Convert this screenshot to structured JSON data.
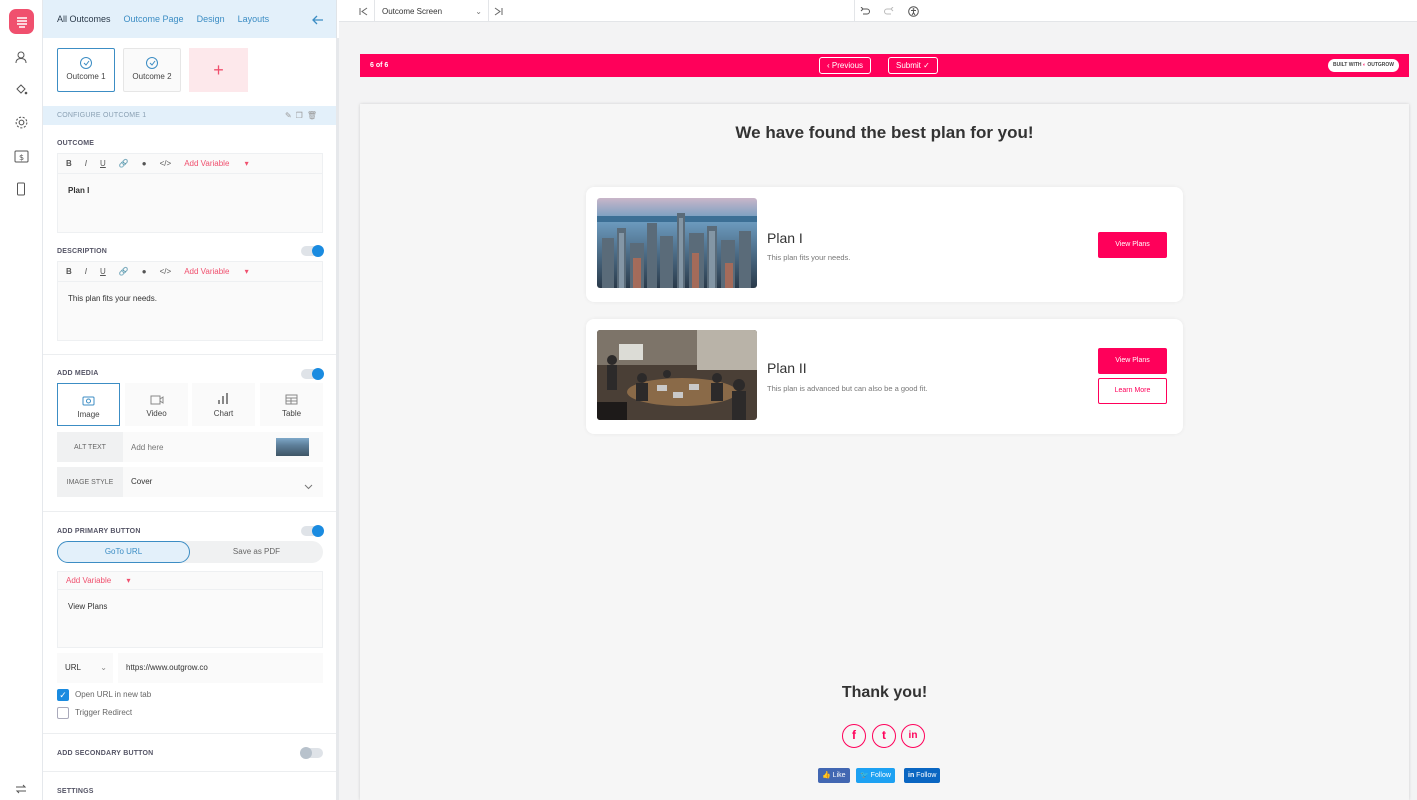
{
  "sidebar": {
    "tabs": [
      "All Outcomes",
      "Outcome Page",
      "Design",
      "Layouts"
    ],
    "outcomes": [
      "Outcome 1",
      "Outcome 2"
    ],
    "add_symbol": "+",
    "configure_label": "CONFIGURE OUTCOME 1",
    "outcome_section": "OUTCOME",
    "toolbar": {
      "bold": "B",
      "italic": "I",
      "underline": "U",
      "add_variable": "Add Variable"
    },
    "outcome_text": "Plan I",
    "description_section": "DESCRIPTION",
    "description_text": "This plan fits your needs.",
    "media_section": "ADD MEDIA",
    "media_options": [
      "Image",
      "Video",
      "Chart",
      "Table"
    ],
    "alt_text_label": "ALT TEXT",
    "alt_text_placeholder": "Add here",
    "image_style_label": "IMAGE STYLE",
    "image_style_value": "Cover",
    "primary_button_section": "ADD PRIMARY BUTTON",
    "primary_tabs": [
      "GoTo URL",
      "Save as PDF"
    ],
    "button_text": "View Plans",
    "url_type": "URL",
    "url_value": "https://www.outgrow.co",
    "open_new_tab": "Open URL in new tab",
    "trigger_redirect": "Trigger Redirect",
    "secondary_button_section": "ADD SECONDARY BUTTON",
    "settings_section": "SETTINGS",
    "toggles": {
      "description": true,
      "media": true,
      "primary": true,
      "secondary": false
    },
    "checkboxes": {
      "open_new_tab": true,
      "trigger_redirect": false
    }
  },
  "topbar": {
    "screen_select": "Outcome Screen"
  },
  "preview": {
    "progress": "6 of 6",
    "previous": "Previous",
    "submit": "Submit",
    "built_with": "BUILT WITH",
    "brand": "OUTGROW",
    "title": "We have found the best plan for you!",
    "cards": [
      {
        "title": "Plan I",
        "desc": "This plan fits your needs.",
        "primary": "View Plans"
      },
      {
        "title": "Plan II",
        "desc": "This plan is advanced but can also be a good fit.",
        "primary": "View Plans",
        "secondary": "Learn More"
      }
    ],
    "thanks": "Thank you!",
    "social_icons": [
      "f",
      "t",
      "in"
    ],
    "social_buttons": [
      "Like",
      "Follow",
      "Follow"
    ]
  },
  "colors": {
    "accent": "#ff005a",
    "blue": "#1a8be0",
    "panel_tab": "#e3f0fa"
  }
}
